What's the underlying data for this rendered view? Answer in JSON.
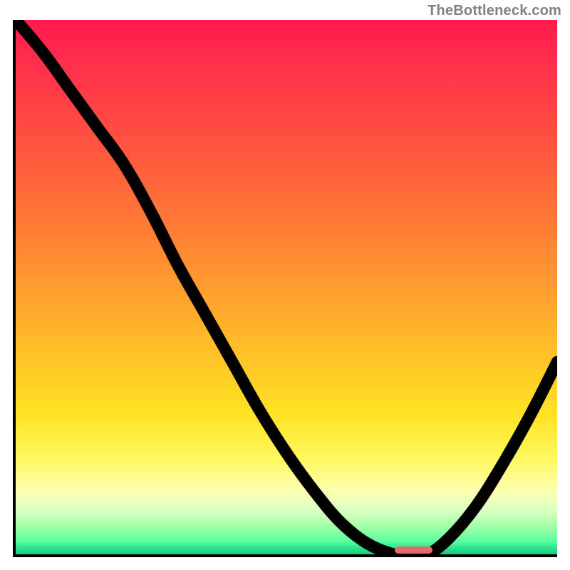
{
  "watermark": "TheBottleneck.com",
  "chart_data": {
    "type": "line",
    "title": "",
    "xlabel": "",
    "ylabel": "",
    "xlim": [
      0,
      100
    ],
    "ylim": [
      0,
      100
    ],
    "grid": false,
    "legend": false,
    "background": "vertical red-yellow-green gradient (bottleneck severity)",
    "x": [
      0,
      5,
      10,
      15,
      20,
      25,
      30,
      35,
      40,
      45,
      50,
      55,
      60,
      65,
      70,
      73,
      76,
      80,
      85,
      90,
      95,
      100
    ],
    "values": [
      100,
      94,
      87,
      80,
      73,
      64,
      54,
      45,
      36,
      27,
      19,
      12,
      6,
      2,
      0,
      0,
      0,
      3,
      9,
      17,
      26,
      36
    ],
    "minimum_marker": {
      "x_start": 70,
      "x_end": 77,
      "y": 0
    },
    "annotations": []
  },
  "colors": {
    "frame": "#000000",
    "curve": "#000000",
    "marker": "#e36b6b",
    "watermark": "#808080"
  }
}
